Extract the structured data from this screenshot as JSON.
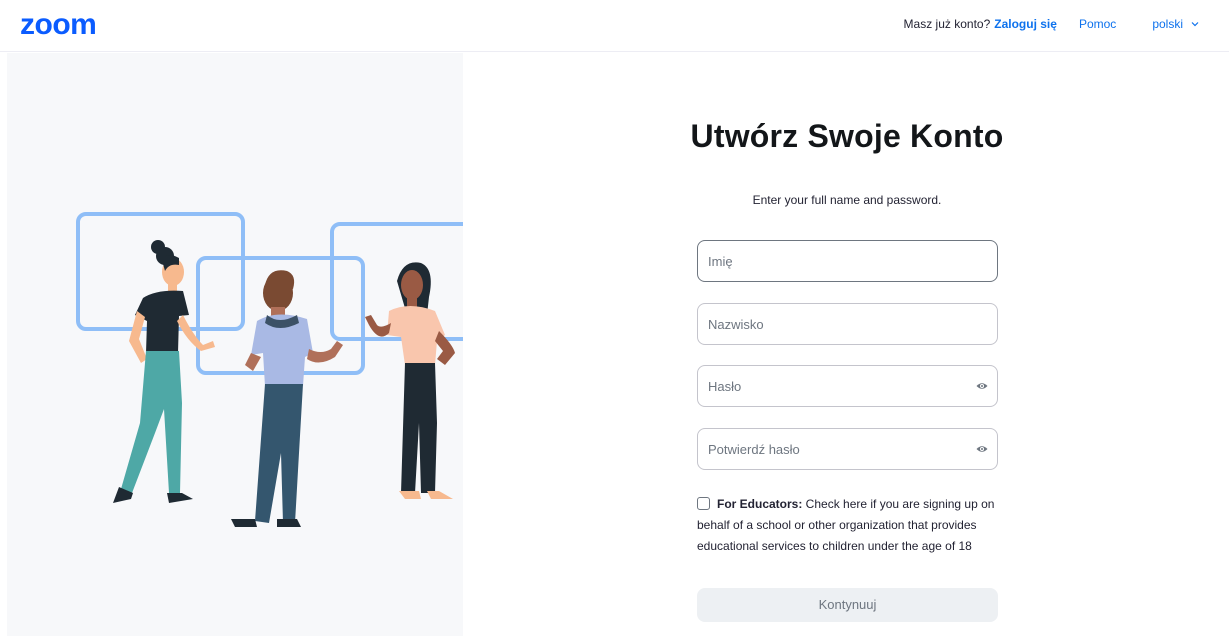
{
  "header": {
    "logo_text": "zoom",
    "have_account": "Masz już konto?",
    "login_link": "Zaloguj się",
    "help_link": "Pomoc",
    "language": "polski",
    "language_icon": "chevron-down-icon"
  },
  "illustration": {
    "description_icon": "people-collaborating-illustration"
  },
  "form": {
    "title": "Utwórz Swoje Konto",
    "subtitle": "Enter your full name and password.",
    "first_name": {
      "placeholder": "Imię",
      "value": ""
    },
    "last_name": {
      "placeholder": "Nazwisko",
      "value": ""
    },
    "password": {
      "placeholder": "Hasło",
      "value": "",
      "icon": "eye-icon"
    },
    "confirm_password": {
      "placeholder": "Potwierdź hasło",
      "value": "",
      "icon": "eye-icon"
    },
    "educators": {
      "checked": false,
      "label_bold": "For Educators:",
      "label_text": " Check here if you are signing up on behalf of a school or other organization that provides educational services to children under the age of 18"
    },
    "continue_button": "Kontynuuj"
  },
  "colors": {
    "brand_blue": "#0b5cff",
    "link_blue": "#0e72ed",
    "frame_blue": "#8fbef7",
    "panel_bg": "#f7f8fa",
    "disabled_button_bg": "#edf0f3"
  }
}
